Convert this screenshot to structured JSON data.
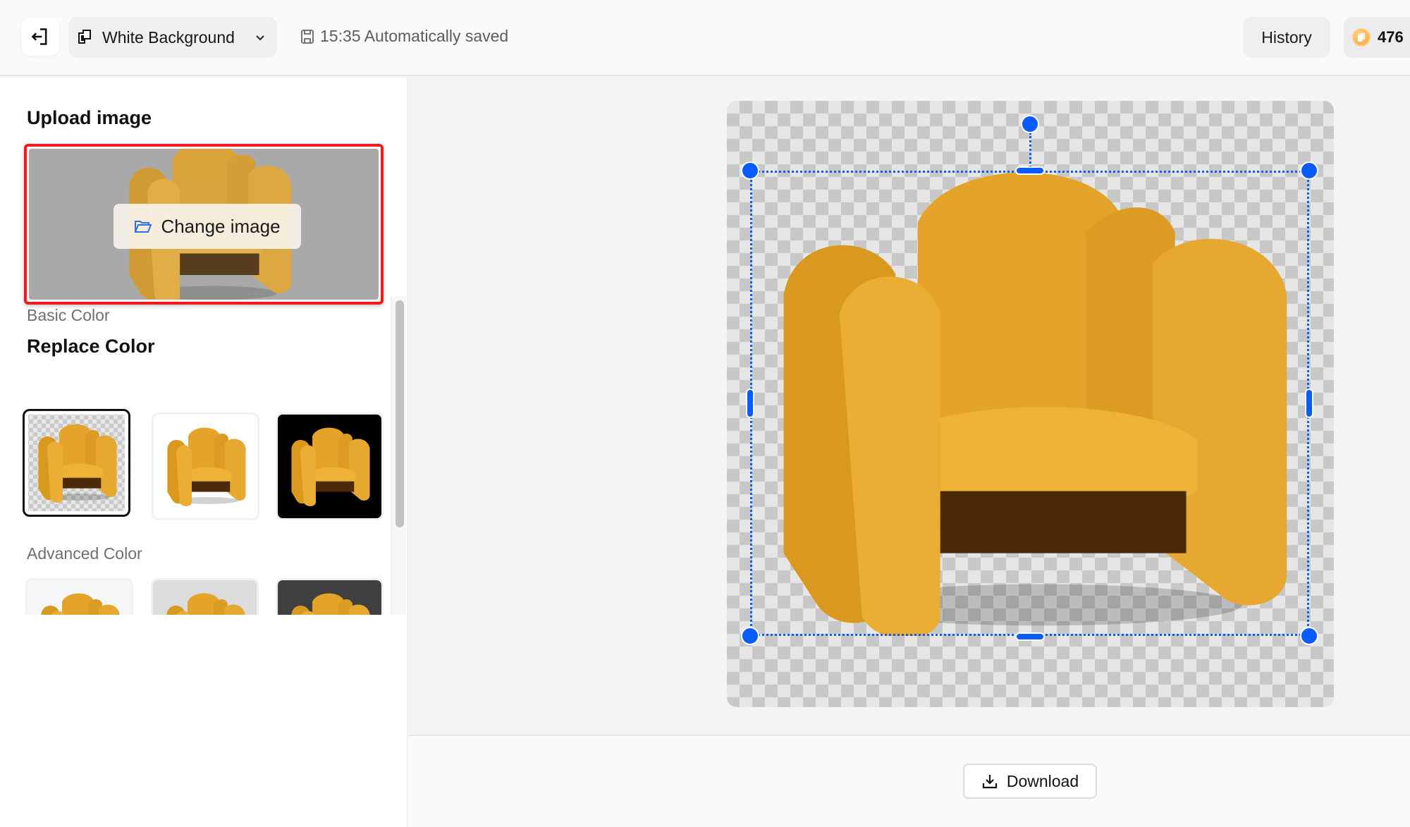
{
  "header": {
    "exit_icon": "exit-icon",
    "tool_name": "White Background",
    "tool_icon": "logo-icon",
    "autosave_text": "15:35 Automatically saved",
    "history_label": "History",
    "credits": "476"
  },
  "sidebar": {
    "upload_title": "Upload image",
    "change_image_label": "Change image",
    "replace_color_title": "Replace Color",
    "basic_color_label": "Basic Color",
    "advanced_color_label": "Advanced Color",
    "basic_colors": [
      {
        "name": "Transparent",
        "value": "transparent",
        "selected": true
      },
      {
        "name": "White",
        "value": "#ffffff",
        "selected": false
      },
      {
        "name": "Black",
        "value": "#000000",
        "selected": false
      }
    ],
    "advanced_colors": [
      {
        "value": "#f5f6f8"
      },
      {
        "value": "#dcdcdc"
      },
      {
        "value": "#3f3f3f"
      },
      {
        "value": "#fffbe1"
      },
      {
        "value": "#f8e8e2"
      },
      {
        "value": "#7d988a"
      }
    ]
  },
  "canvas": {
    "background": "transparent",
    "subject": "yellow boucle armchair"
  },
  "footer": {
    "download_label": "Download"
  },
  "colors": {
    "accent": "#0a5cff",
    "highlight_border": "#ee1c1c",
    "chair": "#e8a92f"
  }
}
